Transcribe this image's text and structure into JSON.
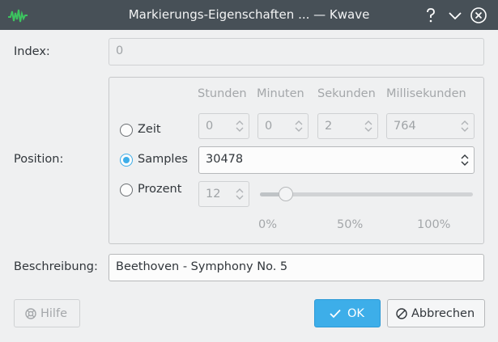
{
  "window": {
    "title": "Markierungs-Eigenschaften ... — Kwave",
    "help_label": "?",
    "minimize_label": "minimize",
    "close_label": "close"
  },
  "index": {
    "label": "Index:",
    "value": "0"
  },
  "position": {
    "label": "Position:",
    "columns": [
      "Stunden",
      "Minuten",
      "Sekunden",
      "Millisekunden"
    ],
    "zeit": {
      "label": "Zeit",
      "checked": false,
      "stunden": "0",
      "minuten": "0",
      "sekunden": "2",
      "millisekunden": "764"
    },
    "samples": {
      "label": "Samples",
      "checked": true,
      "value": "30478"
    },
    "prozent": {
      "label": "Prozent",
      "checked": false,
      "value": "12",
      "slider_level_percent": 12,
      "ticks": [
        "0%",
        "50%",
        "100%"
      ]
    }
  },
  "beschreibung": {
    "label": "Beschreibung:",
    "value": "Beethoven - Symphony No. 5"
  },
  "buttons": {
    "help": "Hilfe",
    "ok": "OK",
    "cancel": "Abbrechen"
  },
  "colors": {
    "accent": "#3daee9",
    "titlebar": "#475057",
    "background": "#eff0f1"
  },
  "icons": {
    "app": "waveform-icon",
    "help": "help-lifebuoy-icon",
    "ok": "checkmark-icon",
    "cancel": "cancel-circle-icon",
    "spin": "spin-up-down-icon"
  }
}
